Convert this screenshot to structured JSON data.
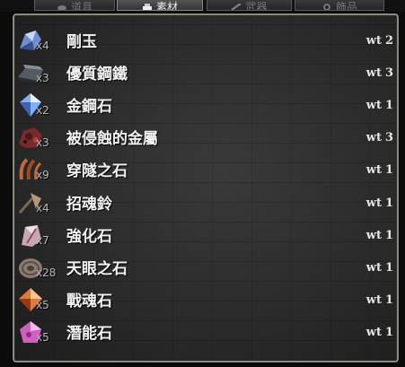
{
  "tabs": [
    {
      "label": "道具",
      "icon": "pouch-icon"
    },
    {
      "label": "素材",
      "icon": "materials-icon",
      "active": true
    },
    {
      "label": "武器",
      "icon": "sword-icon"
    },
    {
      "label": "飾品",
      "icon": "trinket-icon"
    }
  ],
  "weight_label": "wt",
  "items": [
    {
      "name": "剛玉",
      "qty": "x4",
      "wt": "2",
      "icon": "corundum-icon",
      "color": "#6f8fd0"
    },
    {
      "name": "優質鋼鐵",
      "qty": "x3",
      "wt": "3",
      "icon": "steel-ingot-icon",
      "color": "#8a8f96"
    },
    {
      "name": "金鋼石",
      "qty": "x2",
      "wt": "1",
      "icon": "diamond-icon",
      "color": "#7fb0ff"
    },
    {
      "name": "被侵蝕的金屬",
      "qty": "x3",
      "wt": "3",
      "icon": "corroded-metal-icon",
      "color": "#7a2a28"
    },
    {
      "name": "穿隧之石",
      "qty": "x9",
      "wt": "1",
      "icon": "tunneling-stone-icon",
      "color": "#c06a3a"
    },
    {
      "name": "招魂鈴",
      "qty": "x4",
      "wt": "1",
      "icon": "soul-bell-icon",
      "color": "#b09a7a"
    },
    {
      "name": "強化石",
      "qty": "x7",
      "wt": "1",
      "icon": "upgrade-stone-icon",
      "color": "#c8a8b0"
    },
    {
      "name": "天眼之石",
      "qty": "x28",
      "wt": "1",
      "icon": "heaven-eye-stone-icon",
      "color": "#8a7a70"
    },
    {
      "name": "戰魂石",
      "qty": "x5",
      "wt": "1",
      "icon": "war-soul-stone-icon",
      "color": "#e07a3a"
    },
    {
      "name": "潛能石",
      "qty": "x5",
      "wt": "1",
      "icon": "potential-stone-icon",
      "color": "#d060c0"
    }
  ]
}
